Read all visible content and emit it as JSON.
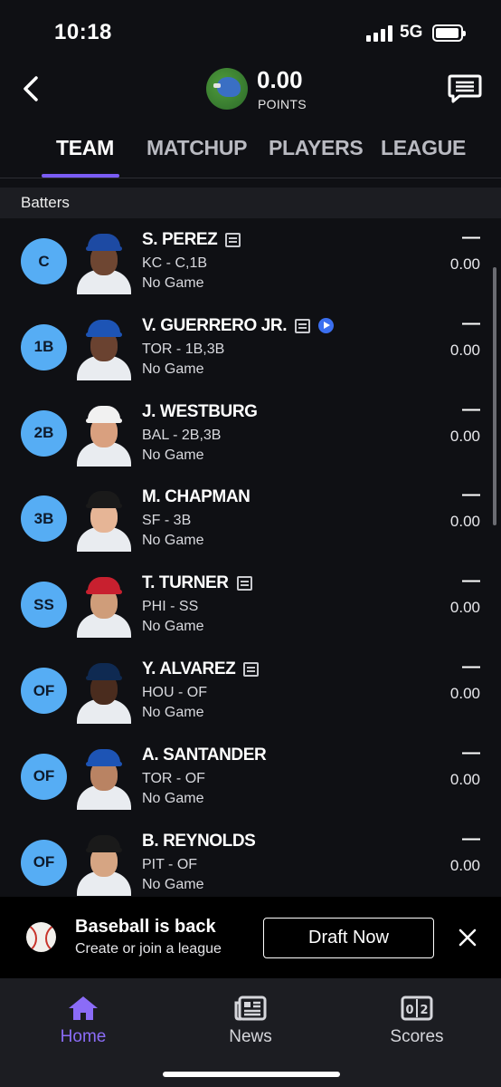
{
  "status_bar": {
    "time": "10:18",
    "network": "5G"
  },
  "header": {
    "points_value": "0.00",
    "points_label": "POINTS"
  },
  "tabs": [
    {
      "label": "TEAM",
      "active": true
    },
    {
      "label": "MATCHUP",
      "active": false
    },
    {
      "label": "PLAYERS",
      "active": false
    },
    {
      "label": "LEAGUE",
      "active": false
    }
  ],
  "section_title": "Batters",
  "players": [
    {
      "pos": "C",
      "name": "S. PEREZ",
      "team_pos": "KC - C,1B",
      "game": "No Game",
      "dash": "—",
      "score": "0.00",
      "note": true,
      "video": false,
      "cap": "#1d4aa3"
    },
    {
      "pos": "1B",
      "name": "V. GUERRERO JR.",
      "team_pos": "TOR - 1B,3B",
      "game": "No Game",
      "dash": "—",
      "score": "0.00",
      "note": true,
      "video": true,
      "cap": "#1d54b5"
    },
    {
      "pos": "2B",
      "name": "J. WESTBURG",
      "team_pos": "BAL - 2B,3B",
      "game": "No Game",
      "dash": "—",
      "score": "0.00",
      "note": false,
      "video": false,
      "cap": "#f1f1f1"
    },
    {
      "pos": "3B",
      "name": "M. CHAPMAN",
      "team_pos": "SF - 3B",
      "game": "No Game",
      "dash": "—",
      "score": "0.00",
      "note": false,
      "video": false,
      "cap": "#1a1a1a"
    },
    {
      "pos": "SS",
      "name": "T. TURNER",
      "team_pos": "PHI - SS",
      "game": "No Game",
      "dash": "—",
      "score": "0.00",
      "note": true,
      "video": false,
      "cap": "#c8202f"
    },
    {
      "pos": "OF",
      "name": "Y. ALVAREZ",
      "team_pos": "HOU - OF",
      "game": "No Game",
      "dash": "—",
      "score": "0.00",
      "note": true,
      "video": false,
      "cap": "#0f2a52"
    },
    {
      "pos": "OF",
      "name": "A. SANTANDER",
      "team_pos": "TOR - OF",
      "game": "No Game",
      "dash": "—",
      "score": "0.00",
      "note": false,
      "video": false,
      "cap": "#1d54b5"
    },
    {
      "pos": "OF",
      "name": "B. REYNOLDS",
      "team_pos": "PIT - OF",
      "game": "No Game",
      "dash": "—",
      "score": "0.00",
      "note": false,
      "video": false,
      "cap": "#1a1a1a"
    }
  ],
  "promo": {
    "title": "Baseball is back",
    "subtitle": "Create or join a league",
    "button": "Draft Now"
  },
  "nav": [
    {
      "label": "Home",
      "icon": "home-icon",
      "active": true
    },
    {
      "label": "News",
      "icon": "news-icon",
      "active": false
    },
    {
      "label": "Scores",
      "icon": "scores-icon",
      "active": false
    }
  ],
  "colors": {
    "accent": "#7a5cf5",
    "position_badge": "#56adf4",
    "background": "#0f1014"
  }
}
